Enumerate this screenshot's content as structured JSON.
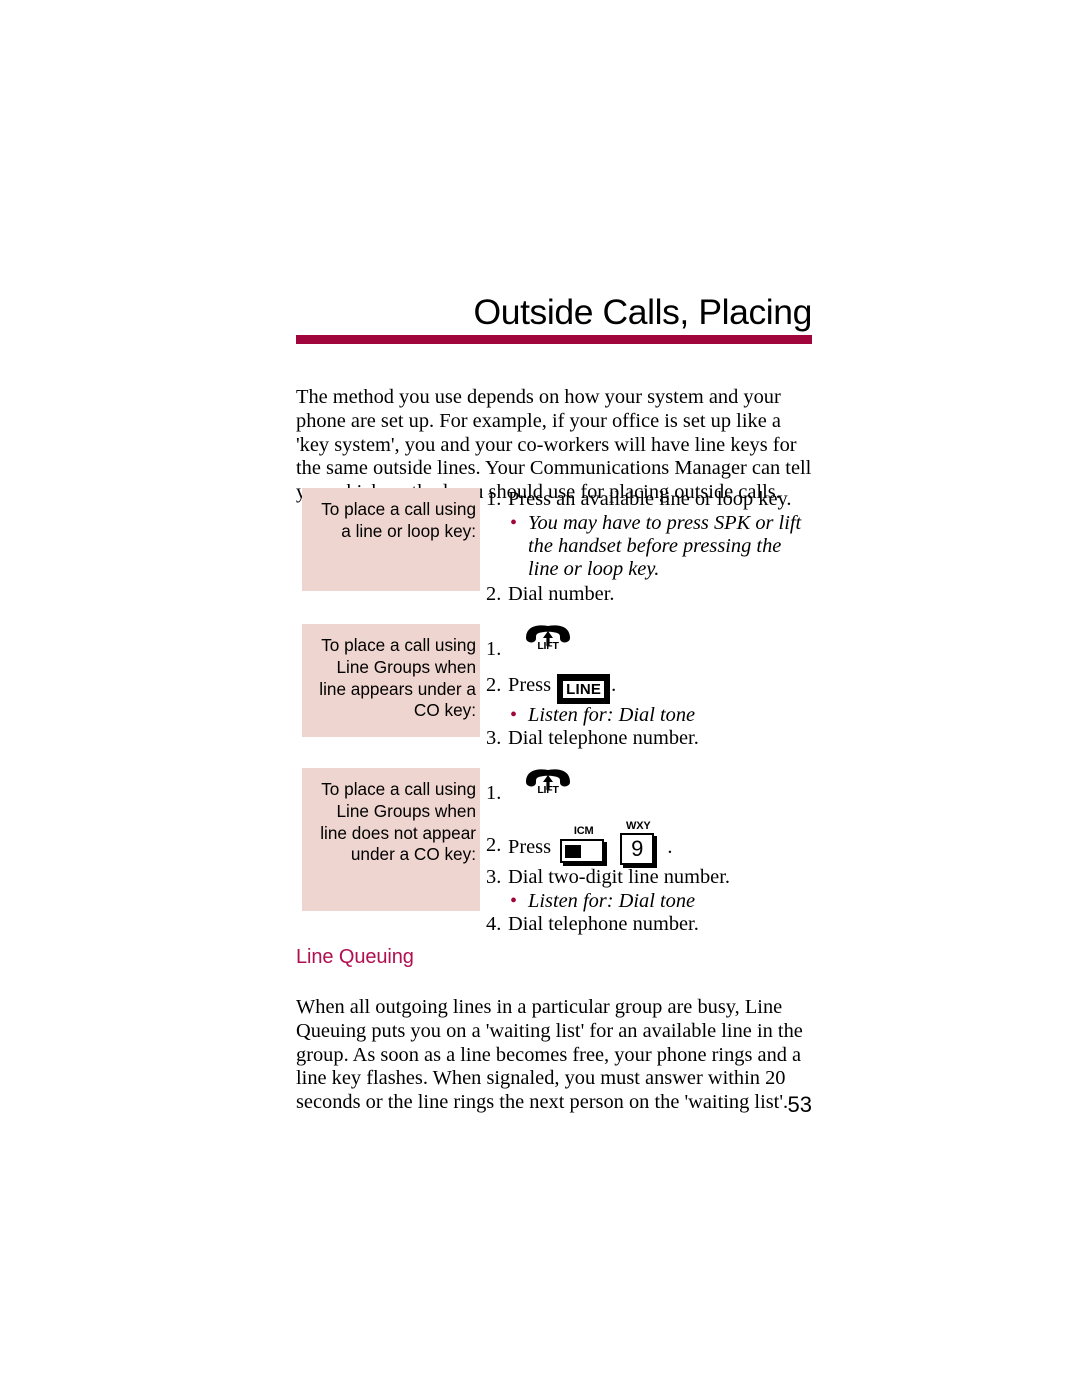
{
  "header": {
    "title": "Outside Calls, Placing",
    "rule_color": "#A0063C"
  },
  "intro": {
    "text": "The method you use depends on how your system and your phone are set up. For example, if your office is set up like a 'key system', you and your co-workers will have line keys for the same outside lines. Your Communications Manager can tell you which method you should use for placing outside calls."
  },
  "blocks": [
    {
      "label": "To place a call using a line or loop key:",
      "steps": [
        {
          "num": "1.",
          "text": "Press an available line or loop key."
        },
        {
          "note": "You may have to press SPK or lift the handset before pressing the line or loop key.",
          "bullet": "•"
        },
        {
          "num": "2.",
          "text": "Dial number."
        }
      ]
    },
    {
      "label": "To place a call using Line Groups when line appears under a CO key:",
      "steps": [
        {
          "num": "1.",
          "text": "",
          "icon": "lift-handset-icon",
          "icon_label": "LIFT"
        },
        {
          "num": "2.",
          "text": "Press",
          "key": "LINE",
          "suffix": "."
        },
        {
          "note": "Listen for: Dial tone",
          "bullet": "•"
        },
        {
          "num": "3.",
          "text": "Dial telephone number."
        }
      ]
    },
    {
      "label": "To place a call using Line Groups when line does not appear under a CO key:",
      "steps": [
        {
          "num": "1.",
          "text": "",
          "icon": "lift-handset-icon",
          "icon_label": "LIFT"
        },
        {
          "num": "2.",
          "text": "Press",
          "key_icm": "ICM",
          "key_digit": "9",
          "key_digit_cap": "WXY",
          "suffix": "."
        },
        {
          "num": "3.",
          "text": "Dial two-digit line number."
        },
        {
          "note": "Listen for: Dial tone",
          "bullet": "•"
        },
        {
          "num": "4.",
          "text": "Dial telephone number."
        }
      ]
    }
  ],
  "line_queuing": {
    "heading": "Line Queuing",
    "heading_color": "#B01050",
    "text": "When all outgoing lines in a particular group are busy, Line Queuing puts you on a 'waiting list' for an available line in the group. As soon as a line becomes free, your phone rings and a line key flashes. When signaled, you must answer within 20 seconds or the line rings the next person on the 'waiting list'."
  },
  "page_number": "53",
  "colors": {
    "accent_maroon": "#A0063C",
    "block_pink": "#EFD5CF",
    "heading_crimson": "#B01050"
  }
}
